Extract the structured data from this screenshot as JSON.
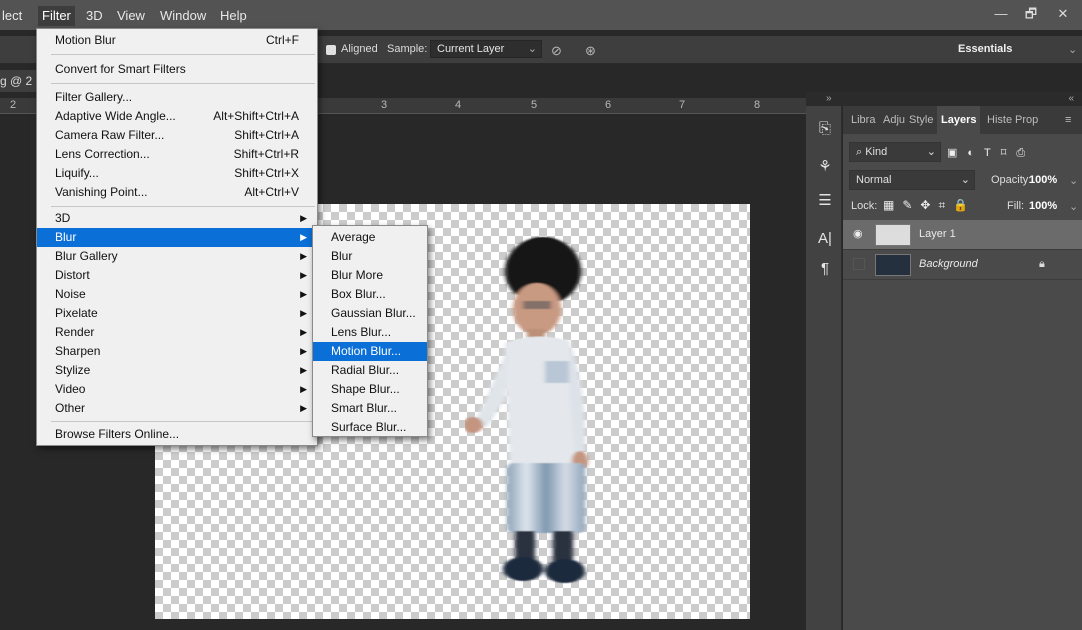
{
  "menubar": {
    "items": [
      "lect",
      "Filter",
      "3D",
      "View",
      "Window",
      "Help"
    ],
    "minimize": "—",
    "restore": "🗗",
    "close": "✕"
  },
  "options": {
    "aligned_label": "Aligned",
    "sample_label": "Sample:",
    "sample_value": "Current Layer",
    "workspace": "Essentials"
  },
  "doc": {
    "tab_label": "g @ 2"
  },
  "ruler": {
    "left_number": "2",
    "numbers": [
      "3",
      "4",
      "5",
      "6",
      "7",
      "8"
    ]
  },
  "filter_menu": {
    "last_filter": {
      "label": "Motion Blur",
      "shortcut": "Ctrl+F"
    },
    "smart": "Convert for Smart Filters",
    "group1": [
      {
        "label": "Filter Gallery...",
        "shortcut": ""
      },
      {
        "label": "Adaptive Wide Angle...",
        "shortcut": "Alt+Shift+Ctrl+A"
      },
      {
        "label": "Camera Raw Filter...",
        "shortcut": "Shift+Ctrl+A"
      },
      {
        "label": "Lens Correction...",
        "shortcut": "Shift+Ctrl+R"
      },
      {
        "label": "Liquify...",
        "shortcut": "Shift+Ctrl+X"
      },
      {
        "label": "Vanishing Point...",
        "shortcut": "Alt+Ctrl+V"
      }
    ],
    "group2": [
      "3D",
      "Blur",
      "Blur Gallery",
      "Distort",
      "Noise",
      "Pixelate",
      "Render",
      "Sharpen",
      "Stylize",
      "Video",
      "Other"
    ],
    "highlighted": "Blur",
    "browse": "Browse Filters Online..."
  },
  "blur_submenu": {
    "items": [
      "Average",
      "Blur",
      "Blur More",
      "Box Blur...",
      "Gaussian Blur...",
      "Lens Blur...",
      "Motion Blur...",
      "Radial Blur...",
      "Shape Blur...",
      "Smart Blur...",
      "Surface Blur..."
    ],
    "highlighted": "Motion Blur..."
  },
  "panel": {
    "tabs": [
      "Libra",
      "Adju",
      "Style",
      "Layers",
      "Histe",
      "Prop"
    ],
    "active_tab": "Layers",
    "kind_label": "Kind",
    "blend_mode": "Normal",
    "opacity_label": "Opacity:",
    "opacity_value": "100%",
    "lock_label": "Lock:",
    "fill_label": "Fill:",
    "fill_value": "100%",
    "layers": [
      {
        "name": "Layer 1",
        "visible": true,
        "selected": true
      },
      {
        "name": "Background",
        "visible": false,
        "selected": false,
        "locked": true
      }
    ]
  },
  "tool_strip": {
    "icons": [
      "libraries-icon",
      "brush-settings-icon",
      "adjust-icon",
      "character-icon",
      "paragraph-icon"
    ]
  },
  "colors": {
    "highlight": "#0a6fd6",
    "menu_bg": "#f0f0f0",
    "app_bg": "#282828"
  }
}
